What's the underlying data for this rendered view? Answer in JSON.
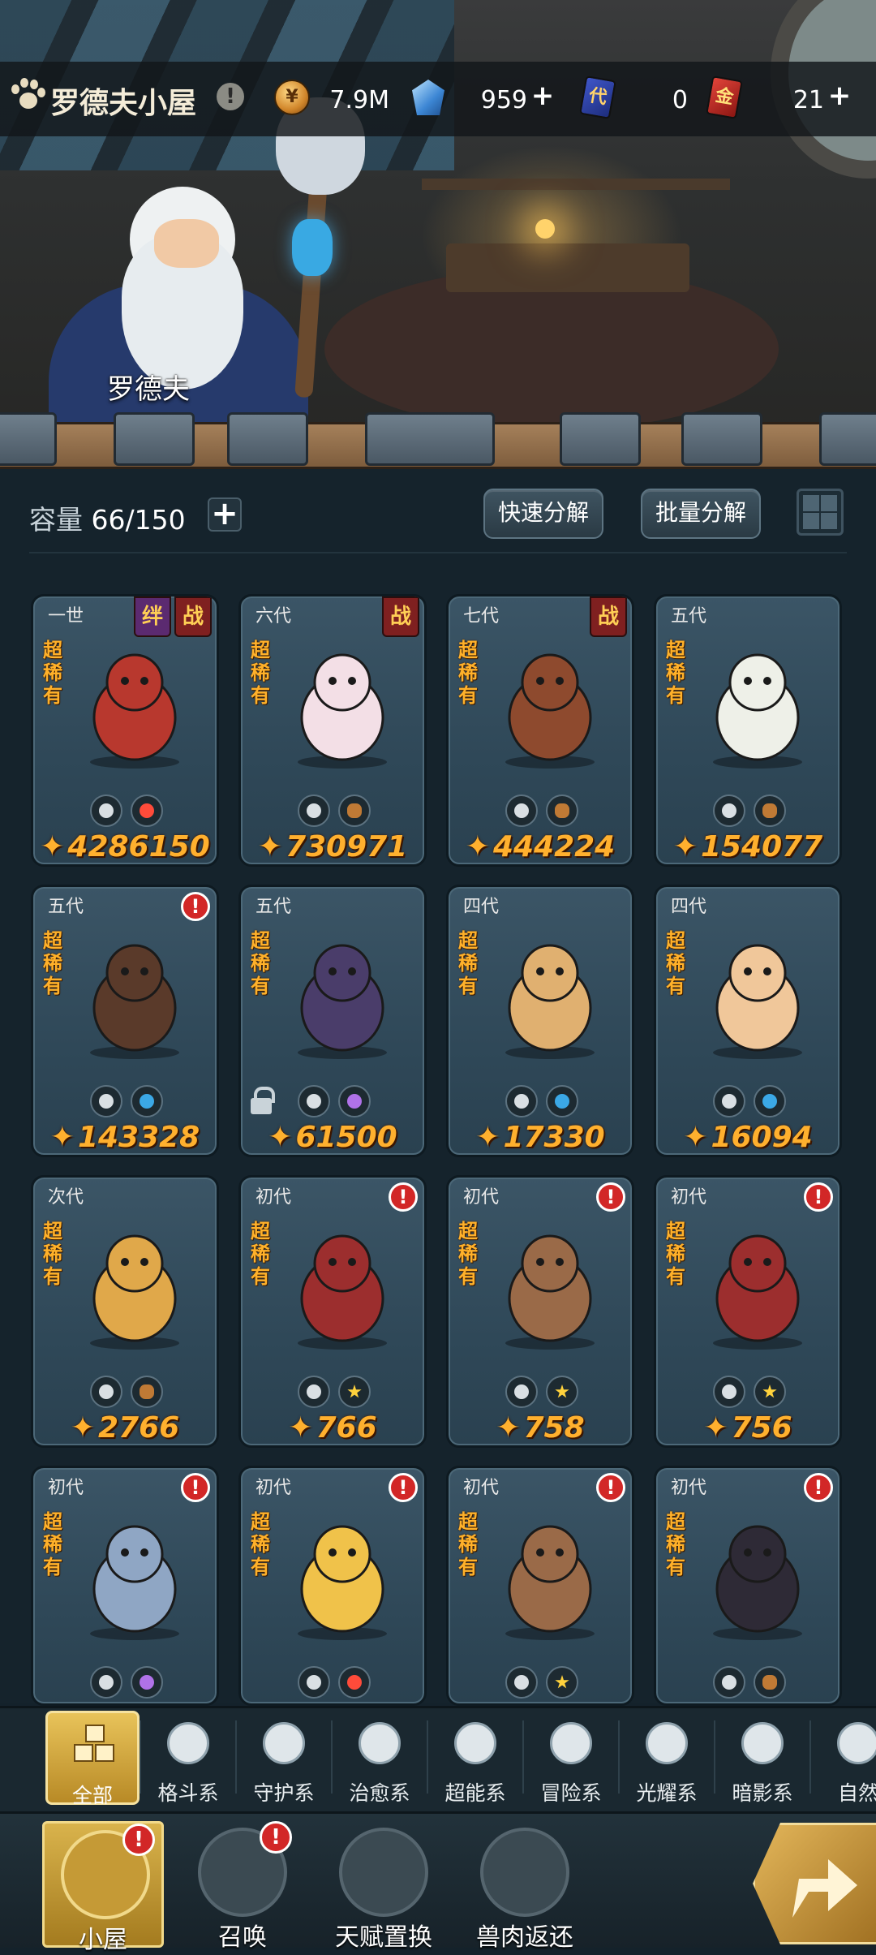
{
  "header": {
    "title": "罗德夫小屋",
    "info_badge": "!",
    "resources": [
      {
        "name": "coin",
        "value": "7.9M",
        "icon": "coin-icon",
        "has_plus": false
      },
      {
        "name": "gem",
        "value": "959",
        "icon": "gem-icon",
        "has_plus": true
      },
      {
        "name": "card-ticket",
        "value": "0",
        "icon": "ticket-card-icon",
        "glyph": "代",
        "has_plus": false
      },
      {
        "name": "gold-card",
        "value": "21",
        "icon": "gold-card-icon",
        "glyph": "金",
        "has_plus": true
      }
    ],
    "plus": "+"
  },
  "hero": {
    "character_name": "罗德夫"
  },
  "capacity": {
    "label": "容量",
    "value": "66/150",
    "plus": "+"
  },
  "actions": {
    "quick_decompose": "快速分解",
    "batch_decompose": "批量分解"
  },
  "pets": [
    {
      "gen": "一世",
      "rarity": "超稀有",
      "power": "4286150",
      "tags": [
        "绊",
        "战"
      ],
      "alert": false,
      "locked": false,
      "elements": [
        "e-grey",
        "e-red"
      ],
      "art_color": "#b8382e"
    },
    {
      "gen": "六代",
      "rarity": "超稀有",
      "power": "730971",
      "tags": [
        "战"
      ],
      "alert": false,
      "locked": false,
      "elements": [
        "e-grey",
        "e-brown"
      ],
      "art_color": "#f3dfe6"
    },
    {
      "gen": "七代",
      "rarity": "超稀有",
      "power": "444224",
      "tags": [
        "战"
      ],
      "alert": false,
      "locked": false,
      "elements": [
        "e-grey",
        "e-brown"
      ],
      "art_color": "#8e4a2e"
    },
    {
      "gen": "五代",
      "rarity": "超稀有",
      "power": "154077",
      "tags": [],
      "alert": false,
      "locked": false,
      "elements": [
        "e-grey",
        "e-brown"
      ],
      "art_color": "#eef0e8"
    },
    {
      "gen": "五代",
      "rarity": "超稀有",
      "power": "143328",
      "tags": [],
      "alert": true,
      "locked": false,
      "elements": [
        "e-grey",
        "e-blue"
      ],
      "art_color": "#5a3a2a"
    },
    {
      "gen": "五代",
      "rarity": "超稀有",
      "power": "61500",
      "tags": [],
      "alert": false,
      "locked": true,
      "elements": [
        "e-grey",
        "e-purple"
      ],
      "art_color": "#4a3d6a"
    },
    {
      "gen": "四代",
      "rarity": "超稀有",
      "power": "17330",
      "tags": [],
      "alert": false,
      "locked": false,
      "elements": [
        "e-grey",
        "e-blue"
      ],
      "art_color": "#e0b070"
    },
    {
      "gen": "四代",
      "rarity": "超稀有",
      "power": "16094",
      "tags": [],
      "alert": false,
      "locked": false,
      "elements": [
        "e-grey",
        "e-blue"
      ],
      "art_color": "#f0c79a"
    },
    {
      "gen": "次代",
      "rarity": "超稀有",
      "power": "2766",
      "tags": [],
      "alert": false,
      "locked": false,
      "elements": [
        "e-grey",
        "e-brown"
      ],
      "art_color": "#e0a84a"
    },
    {
      "gen": "初代",
      "rarity": "超稀有",
      "power": "766",
      "tags": [],
      "alert": true,
      "locked": false,
      "elements": [
        "e-grey",
        "e-yellow"
      ],
      "art_color": "#9c2e2e"
    },
    {
      "gen": "初代",
      "rarity": "超稀有",
      "power": "758",
      "tags": [],
      "alert": true,
      "locked": false,
      "elements": [
        "e-grey",
        "e-yellow"
      ],
      "art_color": "#9a6a48"
    },
    {
      "gen": "初代",
      "rarity": "超稀有",
      "power": "756",
      "tags": [],
      "alert": true,
      "locked": false,
      "elements": [
        "e-grey",
        "e-yellow"
      ],
      "art_color": "#9c2e2e"
    },
    {
      "gen": "初代",
      "rarity": "超稀有",
      "power": "",
      "tags": [],
      "alert": true,
      "locked": false,
      "elements": [
        "e-grey",
        "e-purple"
      ],
      "art_color": "#8fa6c4"
    },
    {
      "gen": "初代",
      "rarity": "超稀有",
      "power": "",
      "tags": [],
      "alert": true,
      "locked": false,
      "elements": [
        "e-grey",
        "e-red"
      ],
      "art_color": "#f0c24a"
    },
    {
      "gen": "初代",
      "rarity": "超稀有",
      "power": "",
      "tags": [],
      "alert": true,
      "locked": false,
      "elements": [
        "e-grey",
        "e-yellow"
      ],
      "art_color": "#9a6a48"
    },
    {
      "gen": "初代",
      "rarity": "超稀有",
      "power": "",
      "tags": [],
      "alert": true,
      "locked": false,
      "elements": [
        "e-grey",
        "e-brown"
      ],
      "art_color": "#2e2a36"
    }
  ],
  "categories": [
    {
      "label": "全部",
      "icon": "all-blocks-icon",
      "active": true
    },
    {
      "label": "格斗系",
      "icon": "fist-icon",
      "active": false
    },
    {
      "label": "守护系",
      "icon": "shield-icon",
      "active": false
    },
    {
      "label": "治愈系",
      "icon": "sprout-icon",
      "active": false
    },
    {
      "label": "超能系",
      "icon": "alien-icon",
      "active": false
    },
    {
      "label": "冒险系",
      "icon": "lantern-icon",
      "active": false
    },
    {
      "label": "光耀系",
      "icon": "star-cross-icon",
      "active": false
    },
    {
      "label": "暗影系",
      "icon": "eye-icon",
      "active": false
    },
    {
      "label": "自然",
      "icon": "leaf-icon",
      "active": false
    }
  ],
  "nav": [
    {
      "label": "小屋",
      "icon": "house-icon",
      "badge": "!",
      "active": true
    },
    {
      "label": "召唤",
      "icon": "egg-icon",
      "badge": "!",
      "active": false
    },
    {
      "label": "天赋置换",
      "icon": "swap-arrows-icon",
      "badge": "",
      "active": false
    },
    {
      "label": "兽肉返还",
      "icon": "meat-icon",
      "badge": "",
      "active": false
    }
  ],
  "power_glyph": "✦"
}
